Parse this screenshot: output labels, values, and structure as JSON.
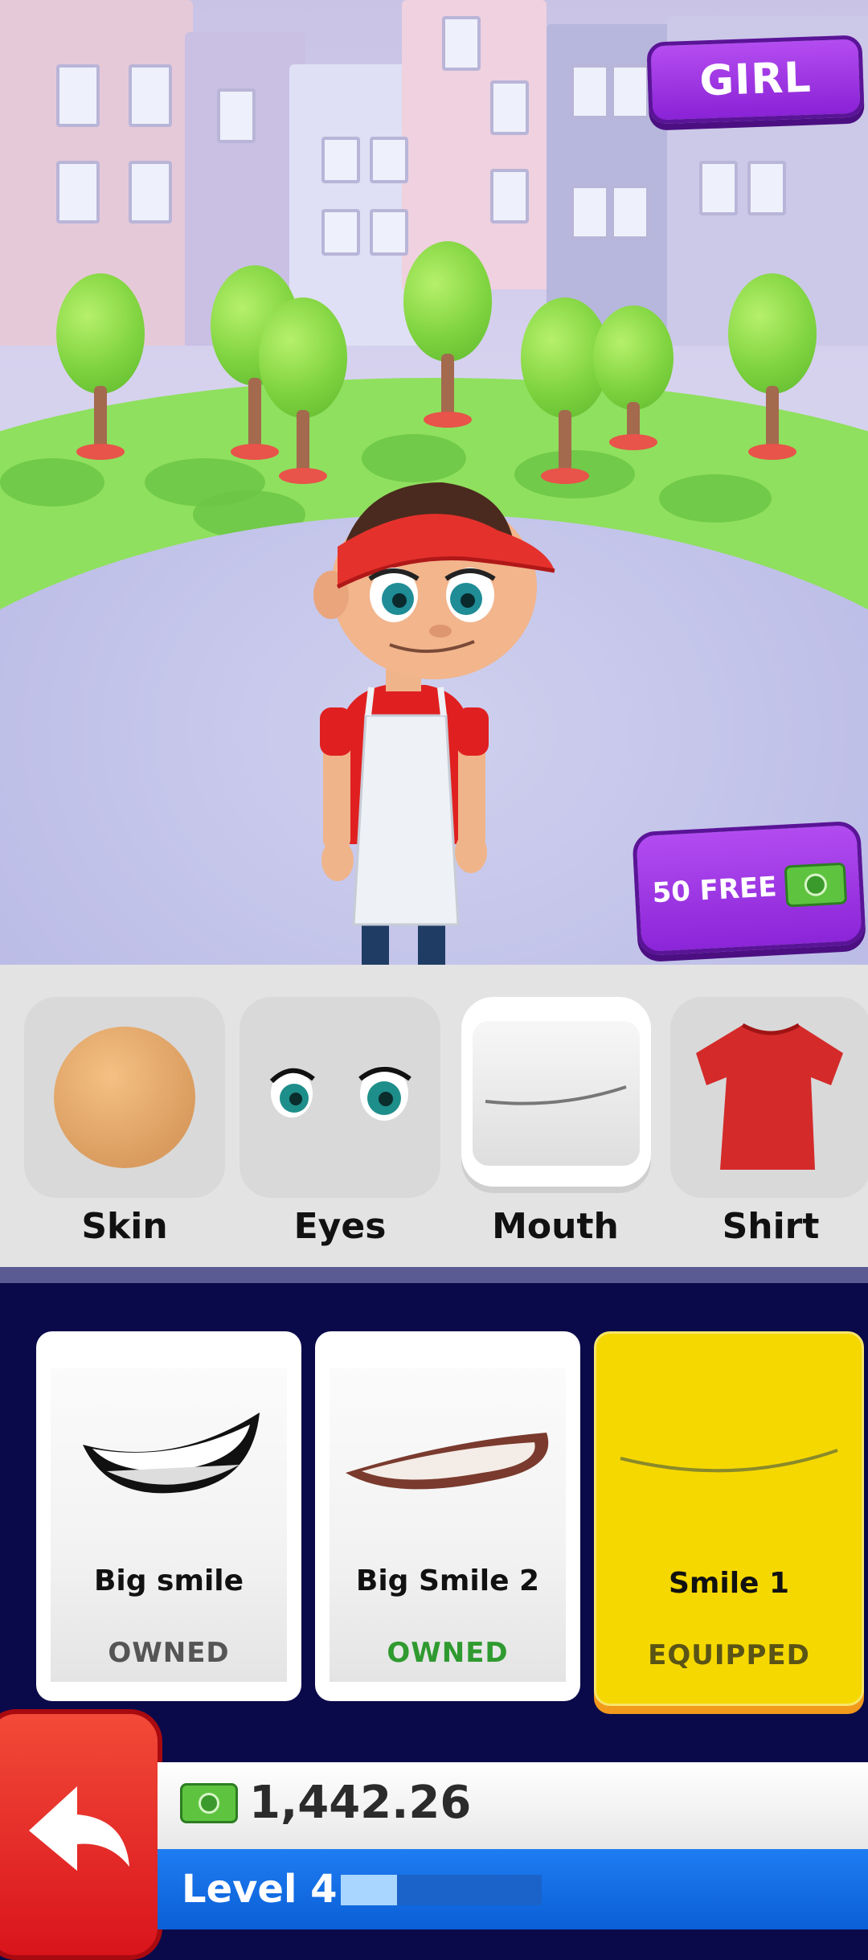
{
  "header": {
    "gender_button": "GIRL"
  },
  "offer_button": {
    "label": "50 FREE",
    "icon": "cash-icon"
  },
  "categories": [
    {
      "label": "Skin",
      "icon": "skin-swatch-icon",
      "selected": false
    },
    {
      "label": "Eyes",
      "icon": "eyes-icon",
      "selected": false
    },
    {
      "label": "Mouth",
      "icon": "mouth-icon",
      "selected": true
    },
    {
      "label": "Shirt",
      "icon": "shirt-icon",
      "selected": false
    }
  ],
  "items": [
    {
      "name": "Big smile",
      "status": "OWNED",
      "status_color": "#555555"
    },
    {
      "name": "Big Smile 2",
      "status": "OWNED",
      "status_color": "#2f9a2f"
    },
    {
      "name": "Smile 1",
      "status": "EQUIPPED",
      "status_color": "#5a5416"
    }
  ],
  "hud": {
    "money": "1,442.26",
    "level": "Level 4",
    "level_progress": 0.28
  },
  "colors": {
    "purple_button": "#9a2fe0",
    "equipped_yellow": "#f5d800",
    "back_red": "#e3202a",
    "level_blue": "#1470e6"
  }
}
